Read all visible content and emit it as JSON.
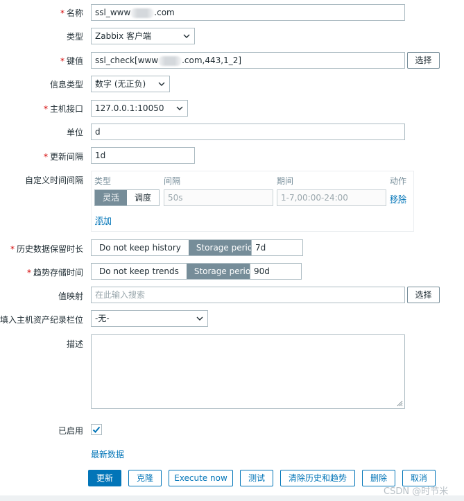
{
  "form": {
    "name": {
      "label": "名称",
      "value_prefix": "ssl_www",
      "value_suffix": ".com"
    },
    "type": {
      "label": "类型",
      "value": "Zabbix 客户端"
    },
    "key": {
      "label": "键值",
      "value_prefix": "ssl_check[www",
      "value_suffix": ".com,443,1_2]",
      "select_label": "选择"
    },
    "info_type": {
      "label": "信息类型",
      "value": "数字 (无正负)"
    },
    "host_interface": {
      "label": "主机接口",
      "value": "127.0.0.1:10050"
    },
    "units": {
      "label": "单位",
      "value": "d"
    },
    "update_interval": {
      "label": "更新间隔",
      "value": "1d"
    },
    "custom_intervals": {
      "label": "自定义时间间隔",
      "columns": {
        "type": "类型",
        "interval": "间隔",
        "period": "期间",
        "action": "动作"
      },
      "row": {
        "type_options": [
          "灵活",
          "调度"
        ],
        "interval_placeholder": "50s",
        "period_placeholder": "1-7,00:00-24:00",
        "remove_label": "移除"
      },
      "add_label": "添加"
    },
    "history": {
      "label": "历史数据保留时长",
      "options": [
        "Do not keep history",
        "Storage period"
      ],
      "value": "7d"
    },
    "trends": {
      "label": "趋势存储时间",
      "options": [
        "Do not keep trends",
        "Storage period"
      ],
      "value": "90d"
    },
    "valuemap": {
      "label": "值映射",
      "placeholder": "在此输入搜索",
      "select_label": "选择"
    },
    "inventory": {
      "label": "填入主机资产纪录栏位",
      "value": "-无-"
    },
    "description": {
      "label": "描述",
      "value": ""
    },
    "enabled": {
      "label": "已启用"
    },
    "latest_data_label": "最新数据"
  },
  "buttons": {
    "update": "更新",
    "clone": "克隆",
    "execute_now": "Execute now",
    "test": "测试",
    "clear": "清除历史和趋势",
    "delete": "删除",
    "cancel": "取消"
  },
  "watermark": "CSDN @时节米",
  "colors": {
    "primary": "#0275b8",
    "required": "#d40000",
    "segment_active": "#768d99",
    "border": "#acbbc2"
  }
}
